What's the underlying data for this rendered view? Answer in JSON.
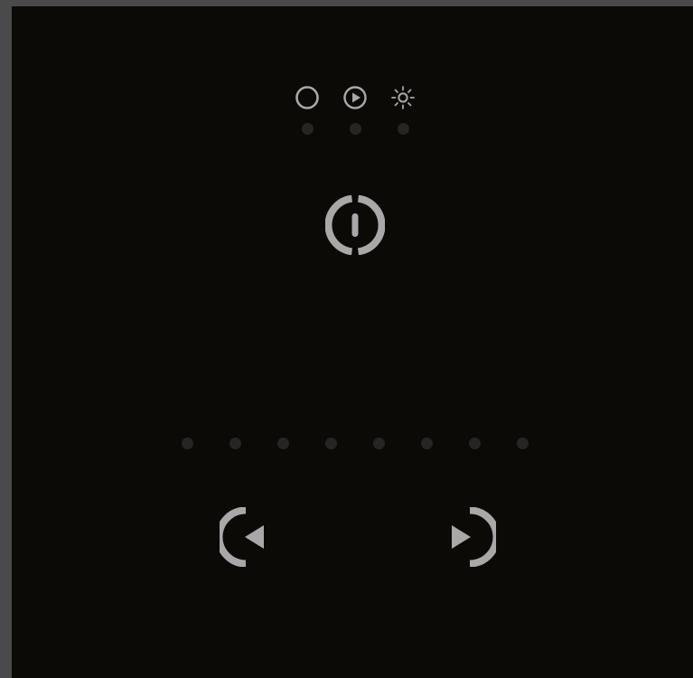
{
  "panel": {
    "background_color": "#0b0a07",
    "outer_color": "#4a4a4a",
    "icon_color": "#a9a7a8",
    "led_off_color": "#262523"
  },
  "mode_buttons": [
    {
      "icon": "circle-icon"
    },
    {
      "icon": "play-icon"
    },
    {
      "icon": "sun-icon"
    }
  ],
  "mode_indicators": [
    {
      "state": "off"
    },
    {
      "state": "off"
    },
    {
      "state": "off"
    }
  ],
  "power_button": {
    "icon": "power-icon"
  },
  "level_indicators": [
    {
      "state": "off"
    },
    {
      "state": "off"
    },
    {
      "state": "off"
    },
    {
      "state": "off"
    },
    {
      "state": "off"
    },
    {
      "state": "off"
    },
    {
      "state": "off"
    },
    {
      "state": "off"
    }
  ],
  "nav_buttons": {
    "previous": {
      "icon": "previous-icon"
    },
    "next": {
      "icon": "next-icon"
    }
  }
}
